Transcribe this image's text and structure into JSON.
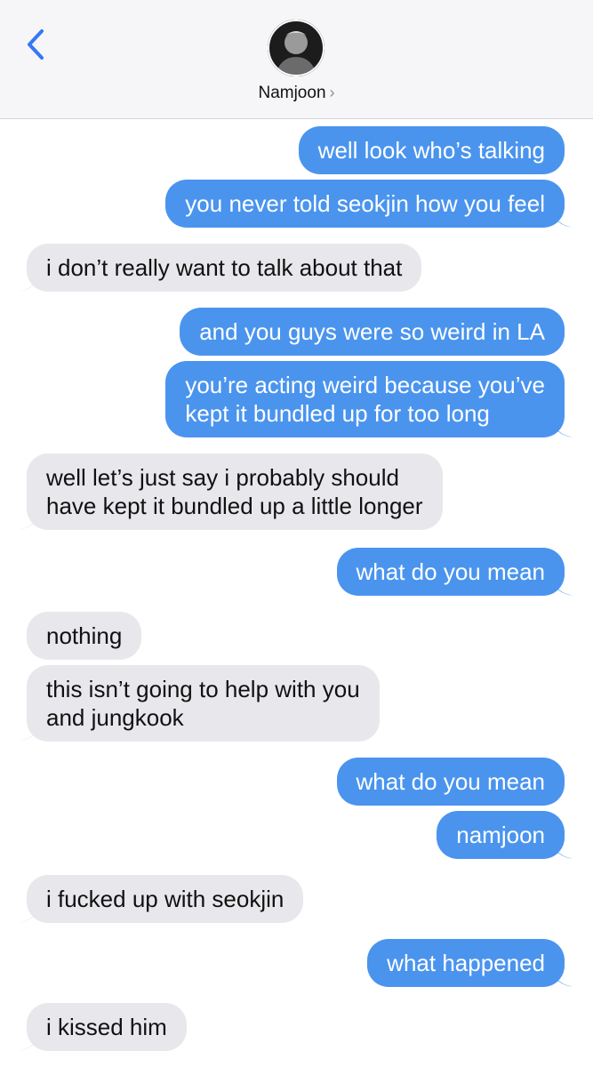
{
  "header": {
    "back_icon": "chevron-left-icon",
    "contact_name": "Namjoon",
    "chevron": "›",
    "accent_color": "#3478f6"
  },
  "colors": {
    "outgoing": "#4a94ee",
    "incoming": "#e8e8ec"
  },
  "messages": [
    {
      "direction": "out",
      "text": "well look who’s talking"
    },
    {
      "direction": "out",
      "text": "you never told seokjin how you feel"
    },
    {
      "direction": "in",
      "text": "i don’t really want to talk about that"
    },
    {
      "direction": "out",
      "text": "and you guys were so weird in LA"
    },
    {
      "direction": "out",
      "lines": [
        "you’re acting weird because you’ve",
        "kept it bundled up for too long"
      ]
    },
    {
      "direction": "in",
      "lines": [
        "well let’s just say i probably should",
        "have kept it bundled up a little longer"
      ]
    },
    {
      "direction": "out",
      "text": "what do you mean"
    },
    {
      "direction": "in",
      "text": "nothing"
    },
    {
      "direction": "in",
      "lines": [
        "this isn’t going to help with you",
        "and jungkook"
      ]
    },
    {
      "direction": "out",
      "text": "what do you mean"
    },
    {
      "direction": "out",
      "text": "namjoon"
    },
    {
      "direction": "in",
      "text": "i fucked up with seokjin"
    },
    {
      "direction": "out",
      "text": "what happened"
    },
    {
      "direction": "in",
      "text": "i kissed him"
    }
  ]
}
